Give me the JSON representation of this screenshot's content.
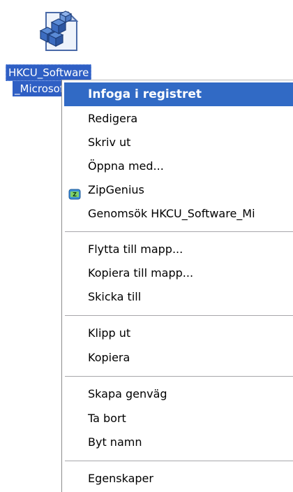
{
  "desktop": {
    "file": {
      "icon": "registry-file-icon",
      "label_line1": "HKCU_Software",
      "label_line2": "_Microsoft"
    }
  },
  "context_menu": {
    "items": [
      {
        "label": "Infoga i registret",
        "default": true,
        "highlighted": true
      },
      {
        "label": "Redigera"
      },
      {
        "label": "Skriv ut"
      },
      {
        "label": "Öppna med..."
      },
      {
        "label": "ZipGenius",
        "icon": "zipgenius-icon"
      },
      {
        "label": "Genomsök HKCU_Software_Mi"
      },
      {
        "label": "Flytta till mapp..."
      },
      {
        "label": "Kopiera till mapp..."
      },
      {
        "label": "Skicka till"
      },
      {
        "label": "Klipp ut"
      },
      {
        "label": "Kopiera"
      },
      {
        "label": "Skapa genväg"
      },
      {
        "label": "Ta bort"
      },
      {
        "label": "Byt namn"
      },
      {
        "label": "Egenskaper"
      }
    ]
  },
  "colors": {
    "highlight": "#316ac5",
    "selection_label_bg": "#2f5fc4"
  }
}
